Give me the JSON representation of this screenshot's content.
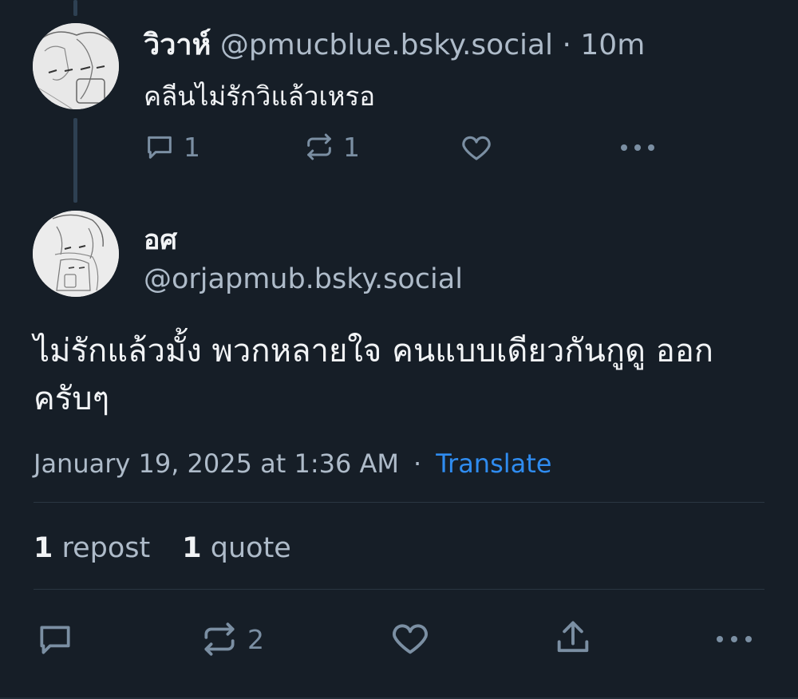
{
  "parent_post": {
    "display_name": "วิวาห์",
    "handle": "@pmucblue.bsky.social",
    "separator": "·",
    "time_ago": "10m",
    "text": "คลีนไม่รักวิแล้วเหรอ",
    "reply_count": "1",
    "repost_count": "1",
    "like_count": "",
    "icons": {
      "reply": "reply-icon",
      "repost": "repost-icon",
      "like": "heart-icon",
      "more": "more-icon"
    }
  },
  "main_post": {
    "display_name": "อศ",
    "handle": "@orjapmub.bsky.social",
    "text": "ไม่รักแล้วมั้ง พวกหลายใจ คนแบบเดียวกันกูดู ออกครับๆ",
    "timestamp": "January 19, 2025 at 1:36 AM",
    "meta_separator": "·",
    "translate_label": "Translate",
    "stats": {
      "repost_count": "1",
      "repost_label": "repost",
      "quote_count": "1",
      "quote_label": "quote"
    },
    "actions": {
      "repost_count": "2"
    }
  },
  "colors": {
    "background": "#161e27",
    "text_primary": "#f1f3f5",
    "text_muted": "#aebbc9",
    "icon": "#7b8fa3",
    "link": "#2f8cf0",
    "thread_line": "#2e4052"
  }
}
